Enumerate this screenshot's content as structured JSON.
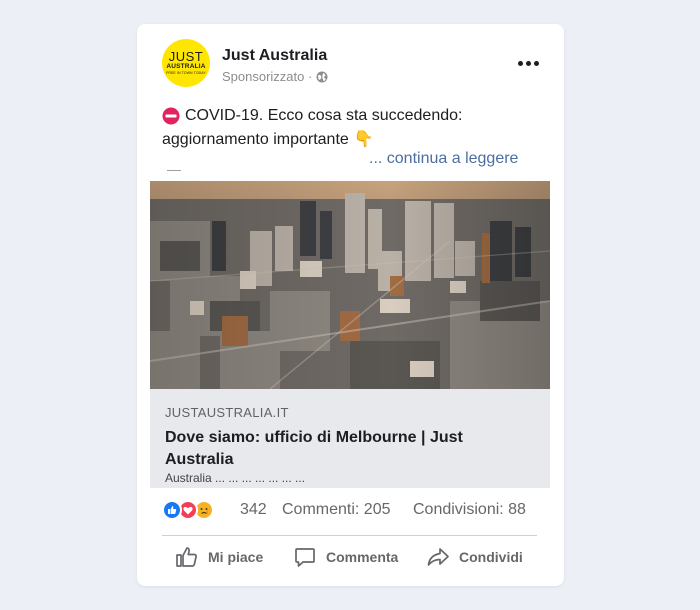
{
  "post": {
    "page_name": "Just Australia",
    "sponsored_label": "Sponsorizzato ·",
    "avatar": {
      "line1": "JUST",
      "line2": "AUSTRALIA",
      "line3": "FREE IN TOWN TODAY"
    },
    "text_line1": "COVID-19. Ecco cosa sta succedendo:",
    "text_line2": "aggiornamento importante",
    "pointing_emoji": "👇",
    "read_more": "... continua a leggere"
  },
  "link_preview": {
    "domain": "JUSTAUSTRALIA.IT",
    "title": "Dove siamo: ufficio di Melbourne | Just Australia",
    "description": "Australia ... ... ... ... ... ... ..."
  },
  "engagement": {
    "reaction_count": "342",
    "comments": "Commenti: 205",
    "shares": "Condivisioni: 88"
  },
  "actions": {
    "like": "Mi piace",
    "comment": "Commenta",
    "share": "Condividi"
  },
  "icons": {
    "globe": "globe-icon",
    "more": "more-options-icon",
    "stop": "no-entry-icon",
    "like": "thumbs-up-icon",
    "comment": "speech-bubble-icon",
    "share": "share-arrow-icon"
  },
  "colors": {
    "background": "#eceff5",
    "card": "#ffffff",
    "link": "#4c6ea0",
    "like_blue": "#1877f2",
    "love_red": "#f33e58",
    "sad_yellow": "#f7b125",
    "avatar_yellow": "#ffe600"
  }
}
